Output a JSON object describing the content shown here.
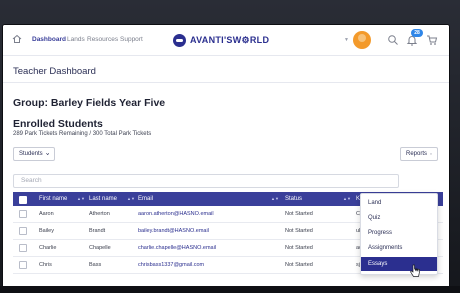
{
  "nav": {
    "links": [
      "Dashboard",
      "Lands",
      "Resources",
      "Support"
    ],
    "brand": "AVANTI'SW⚙RLD",
    "notification_count": "28"
  },
  "header": {
    "title": "Teacher Dashboard"
  },
  "group": {
    "title": "Group: Barley Fields Year Five"
  },
  "enrolled": {
    "title": "Enrolled Students",
    "tickets": "289 Park Tickets Remaining / 300 Total Park Tickets"
  },
  "controls": {
    "students_label": "Students",
    "reports_label": "Reports",
    "search_placeholder": "Search"
  },
  "table": {
    "columns": [
      "First name",
      "Last name",
      "Email",
      "Status",
      "Key"
    ],
    "rows": [
      {
        "first": "Aaron",
        "last": "Atherton",
        "email": "aaron.atherton@HASNO.email",
        "status": "Not Started",
        "key": "CjPCq5oL"
      },
      {
        "first": "Bailey",
        "last": "Brandt",
        "email": "bailey.brandt@HASNO.email",
        "status": "Not Started",
        "key": "uE3Q8ks"
      },
      {
        "first": "Charlie",
        "last": "Chapelle",
        "email": "charlie.chapelle@HASNO.email",
        "status": "Not Started",
        "key": "aoMn9Zut"
      },
      {
        "first": "Chris",
        "last": "Bass",
        "email": "chrisbass1337@gmail.com",
        "status": "Not Started",
        "key": "sjG3tUJ"
      }
    ]
  },
  "reports_menu": {
    "items": [
      "Land",
      "Quiz",
      "Progress",
      "Assignments",
      "Essays"
    ],
    "active_index": 4
  },
  "colors": {
    "brand": "#2b2f8f",
    "header_row": "#3a3f9a",
    "avatar": "#f39a2b",
    "badge": "#2f86e8"
  },
  "icons": [
    "home-icon",
    "search-icon",
    "bell-icon",
    "cart-icon",
    "chevron-down-icon",
    "pointer-cursor-icon"
  ]
}
